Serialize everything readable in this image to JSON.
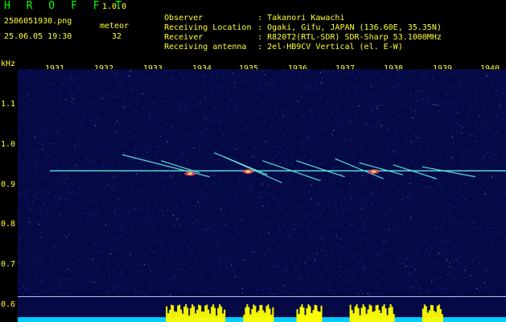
{
  "header": {
    "app_name": "H R O F F T",
    "app_version": "1.0.0",
    "filename": "2506051930.png",
    "datetime": "25.06.05 19:30",
    "meteor_label": "meteor",
    "meteor_count": "32",
    "info": [
      {
        "key": "Observer",
        "value": ": Takanori Kawachi"
      },
      {
        "key": "Receiving Location",
        "value": ": Ogaki, Gifu, JAPAN (136.60E, 35.35N)"
      },
      {
        "key": "Receiver",
        "value": ": R820T2(RTL-SDR) SDR-Sharp 53.1000MHz"
      },
      {
        "key": "Receiving antenna",
        "value": ": 2el-HB9CV Vertical (el. E-W)"
      }
    ]
  },
  "colors": {
    "text_yellow": "#ffff33",
    "title_green": "#00ff00",
    "plot_background": "#050a46",
    "signal_cyan": "#66ffee",
    "activity_yellow": "#ffff00",
    "baseline_cyan": "#00ccff"
  },
  "chart_data": {
    "type": "heatmap",
    "title": "",
    "xlabel": "",
    "ylabel": "kHz",
    "x_ticks": [
      "1931",
      "1932",
      "1933",
      "1934",
      "1935",
      "1936",
      "1937",
      "1938",
      "1939",
      "1940"
    ],
    "y_ticks": [
      "1.1",
      "1.0",
      "0.9",
      "0.8",
      "0.7",
      "0.6"
    ],
    "xlim": [
      1930.6,
      1940
    ],
    "ylim": [
      0.58,
      1.08
    ],
    "carrier_khz": 0.935,
    "carrier_span": [
      1930.9,
      1940
    ],
    "meteor_echoes": [
      {
        "t0": 1932.4,
        "f0": 0.975,
        "t1": 1934.2,
        "f1": 0.92
      },
      {
        "t0": 1933.2,
        "f0": 0.96,
        "t1": 1934.0,
        "f1": 0.93
      },
      {
        "t0": 1934.3,
        "f0": 0.98,
        "t1": 1935.4,
        "f1": 0.925
      },
      {
        "t0": 1934.5,
        "f0": 0.97,
        "t1": 1935.7,
        "f1": 0.905
      },
      {
        "t0": 1935.3,
        "f0": 0.96,
        "t1": 1936.5,
        "f1": 0.91
      },
      {
        "t0": 1936.0,
        "f0": 0.96,
        "t1": 1937.0,
        "f1": 0.92
      },
      {
        "t0": 1936.8,
        "f0": 0.965,
        "t1": 1937.8,
        "f1": 0.915
      },
      {
        "t0": 1937.3,
        "f0": 0.955,
        "t1": 1938.2,
        "f1": 0.925
      },
      {
        "t0": 1938.0,
        "f0": 0.95,
        "t1": 1938.9,
        "f1": 0.915
      },
      {
        "t0": 1938.6,
        "f0": 0.945,
        "t1": 1939.7,
        "f1": 0.92
      }
    ],
    "bright_spots": [
      {
        "t": 1933.8,
        "f": 0.928
      },
      {
        "t": 1935.0,
        "f": 0.933
      },
      {
        "t": 1937.6,
        "f": 0.933
      }
    ],
    "reference_lines_khz": [
      0.62,
      0.6
    ],
    "activity_bursts": [
      {
        "t0": 1933.3,
        "t1": 1934.5
      },
      {
        "t0": 1934.9,
        "t1": 1935.5
      },
      {
        "t0": 1936.0,
        "t1": 1936.5
      },
      {
        "t0": 1937.1,
        "t1": 1938.0
      },
      {
        "t0": 1938.6,
        "t1": 1939.0
      }
    ]
  }
}
